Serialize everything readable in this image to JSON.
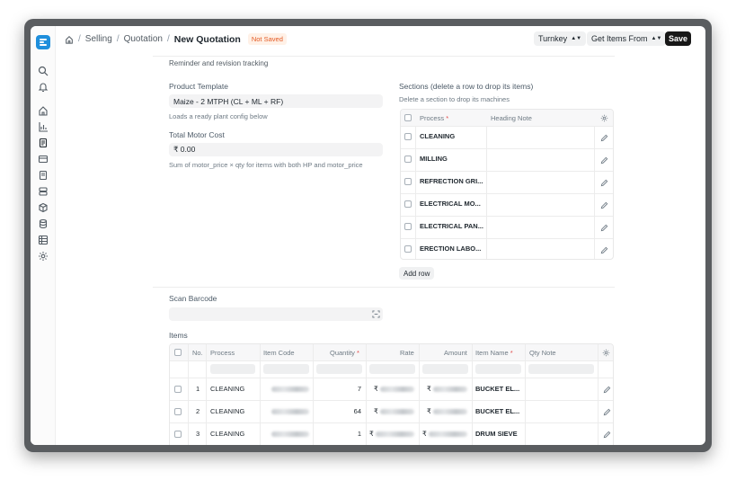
{
  "topbar": {
    "breadcrumbs": [
      "Selling",
      "Quotation"
    ],
    "current": "New Quotation",
    "status_badge": "Not Saved",
    "btn_turnkey": "Turnkey",
    "btn_get_items": "Get Items From",
    "btn_save": "Save"
  },
  "form": {
    "reminder_text": "Reminder and revision tracking",
    "product_template_label": "Product Template",
    "product_template_value": "Maize - 2 MTPH (CL + ML + RF)",
    "product_template_help": "Loads a ready plant config below",
    "total_motor_cost_label": "Total Motor Cost",
    "total_motor_cost_value": "₹ 0.00",
    "total_motor_cost_help": "Sum of motor_price × qty for items with both HP and motor_price",
    "scan_barcode_label": "Scan Barcode",
    "items_label": "Items"
  },
  "sections": {
    "title": "Sections (delete a row to drop its items)",
    "help": "Delete a section to drop its machines",
    "col_process": "Process",
    "col_heading_note": "Heading Note",
    "rows": [
      "CLEANING",
      "MILLING",
      "REFRECTION GRI...",
      "ELECTRICAL MO...",
      "ELECTRICAL PAN...",
      "ERECTION LABO..."
    ],
    "add_row": "Add row"
  },
  "items": {
    "columns": [
      "No.",
      "Process",
      "Item Code",
      "Quantity",
      "Rate",
      "Amount",
      "Item Name",
      "Qty Note"
    ],
    "rows": [
      {
        "no": "1",
        "process": "CLEANING",
        "qty": "7",
        "rate_prefix": "₹",
        "amount_prefix": "₹",
        "item_name": "BUCKET EL..."
      },
      {
        "no": "2",
        "process": "CLEANING",
        "qty": "64",
        "rate_prefix": "₹",
        "amount_prefix": "₹",
        "item_name": "BUCKET EL..."
      },
      {
        "no": "3",
        "process": "CLEANING",
        "qty": "1",
        "rate_prefix": "₹",
        "amount_prefix": "₹",
        "item_name": "DRUM SIEVE"
      }
    ]
  },
  "colors": {
    "accent": "#1f8fdc",
    "badge_text": "#e35a24",
    "badge_bg": "#fff1e7",
    "save_bg": "#171717"
  }
}
